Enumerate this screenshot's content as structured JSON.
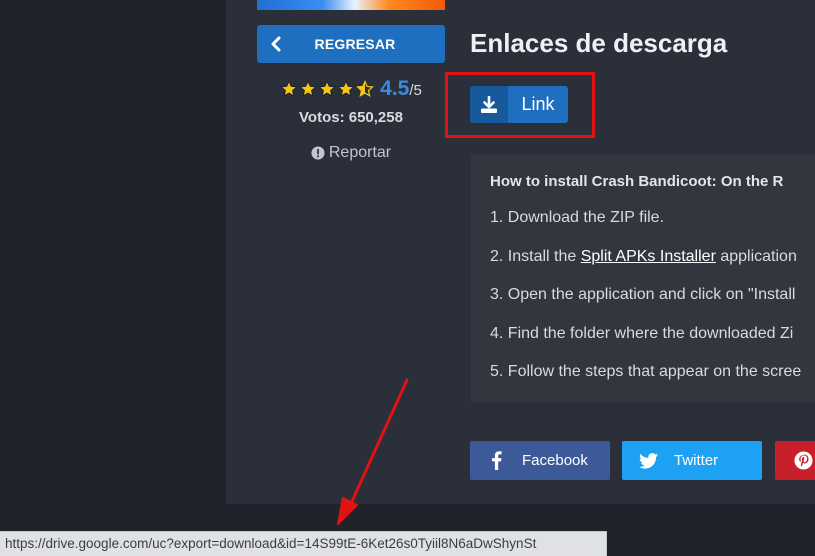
{
  "sidebar": {
    "back_label": "REGRESAR",
    "rating_value": "4.5",
    "rating_max": "/5",
    "stars": 4.5,
    "votes": "Votos: 650,258",
    "report_label": "Reportar"
  },
  "main": {
    "title": "Enlaces de descarga",
    "link_label": "Link",
    "instructions": {
      "title": "How to install Crash Bandicoot: On the R",
      "step1": "1. Download the ZIP file.",
      "step2_prefix": "2. Install the ",
      "step2_link": "Split APKs Installer",
      "step2_suffix": " application",
      "step3": "3. Open the application and click on \"Install",
      "step4": "4. Find the folder where the downloaded Zi",
      "step5": "5. Follow the steps that appear on the scree"
    },
    "share": {
      "facebook": "Facebook",
      "twitter": "Twitter"
    }
  },
  "status_bar": {
    "url": "https://drive.google.com/uc?export=download&id=14S99tE-6Ket26s0Tyiil8N6aDwShynSt"
  },
  "colors": {
    "accent": "#1e6fbf",
    "highlight": "#e01212",
    "star": "#f5c518",
    "facebook": "#3b5a97",
    "twitter": "#1da1f2",
    "pinterest": "#c8202b"
  }
}
